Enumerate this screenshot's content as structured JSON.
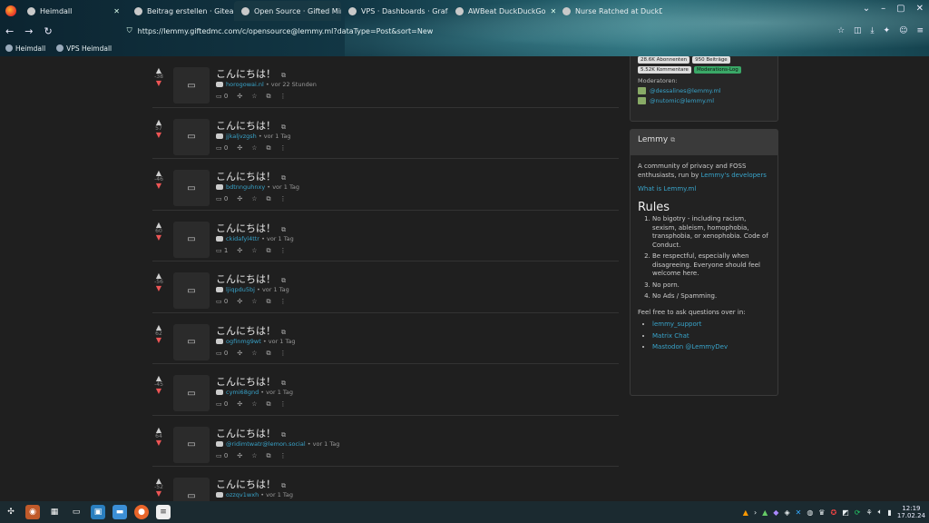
{
  "tabs": [
    {
      "title": "Heimdall",
      "active": false
    },
    {
      "title": "Beitrag erstellen · Gitea",
      "active": false
    },
    {
      "title": "Open Source · Gifted Mind",
      "active": true
    },
    {
      "title": "VPS · Dashboards · Grafana",
      "active": false
    },
    {
      "title": "AWBeat DuckDuckGo",
      "active": false
    },
    {
      "title": "Nurse Ratched at DuckDuckGo",
      "active": false
    }
  ],
  "url": "https://lemmy.giftedmc.com/c/opensource@lemmy.ml?dataType=Post&sort=New",
  "bookmarks": [
    "Heimdall",
    "VPS Heimdall"
  ],
  "posts": [
    {
      "score": "-38",
      "title": "こんにちは！",
      "user": "horogowai.nl",
      "time": "vor 22 Stunden",
      "comments": "0"
    },
    {
      "score": "57",
      "title": "こんにちは！",
      "user": "jjkaljvzgsh",
      "time": "vor 1 Tag",
      "comments": "0"
    },
    {
      "score": "-46",
      "title": "こんにちは！",
      "user": "bdtnnguhnxy",
      "time": "vor 1 Tag",
      "comments": "0"
    },
    {
      "score": "60",
      "title": "こんにちは！",
      "user": "ckidafyl4ttr",
      "time": "vor 1 Tag",
      "comments": "1"
    },
    {
      "score": "-56",
      "title": "こんにちは！",
      "user": "ljiqpdu5bj",
      "time": "vor 1 Tag",
      "comments": "0"
    },
    {
      "score": "62",
      "title": "こんにちは！",
      "user": "ogfinmg9wt",
      "time": "vor 1 Tag",
      "comments": "0"
    },
    {
      "score": "-45",
      "title": "こんにちは！",
      "user": "cymi68gnd",
      "time": "vor 1 Tag",
      "comments": "0"
    },
    {
      "score": "64",
      "title": "こんにちは！",
      "user": "@ridimtwatr@lemon.social",
      "time": "vor 1 Tag",
      "comments": "0"
    },
    {
      "score": "-52",
      "title": "こんにちは！",
      "user": "ozzqv1wxh",
      "time": "vor 1 Tag",
      "comments": "0"
    }
  ],
  "sidebar": {
    "badges": [
      "28.6K Abonnenten",
      "950 Beiträge",
      "5.52K Kommentare",
      "Moderations-Log"
    ],
    "moderators_label": "Moderatoren:",
    "mods": [
      "@dessalines@lemmy.ml",
      "@nutomic@lemmy.ml"
    ],
    "lemmy_title": "Lemmy",
    "lemmy_desc_pre": "A community of privacy and FOSS enthusiasts, run by ",
    "lemmy_desc_link": "Lemmy's developers",
    "what_is": "What is Lemmy.ml",
    "rules_title": "Rules",
    "rules": [
      "No bigotry - including racism, sexism, ableism, homophobia, transphobia, or xenophobia. Code of Conduct.",
      "Be respectful, especially when disagreeing. Everyone should feel welcome here.",
      "No porn.",
      "No Ads / Spamming."
    ],
    "ask": "Feel free to ask questions over in:",
    "links": [
      "lemmy_support",
      "Matrix Chat",
      "Mastodon @LemmyDev"
    ]
  },
  "clock": {
    "time": "12:19",
    "date": "17.02.24"
  }
}
